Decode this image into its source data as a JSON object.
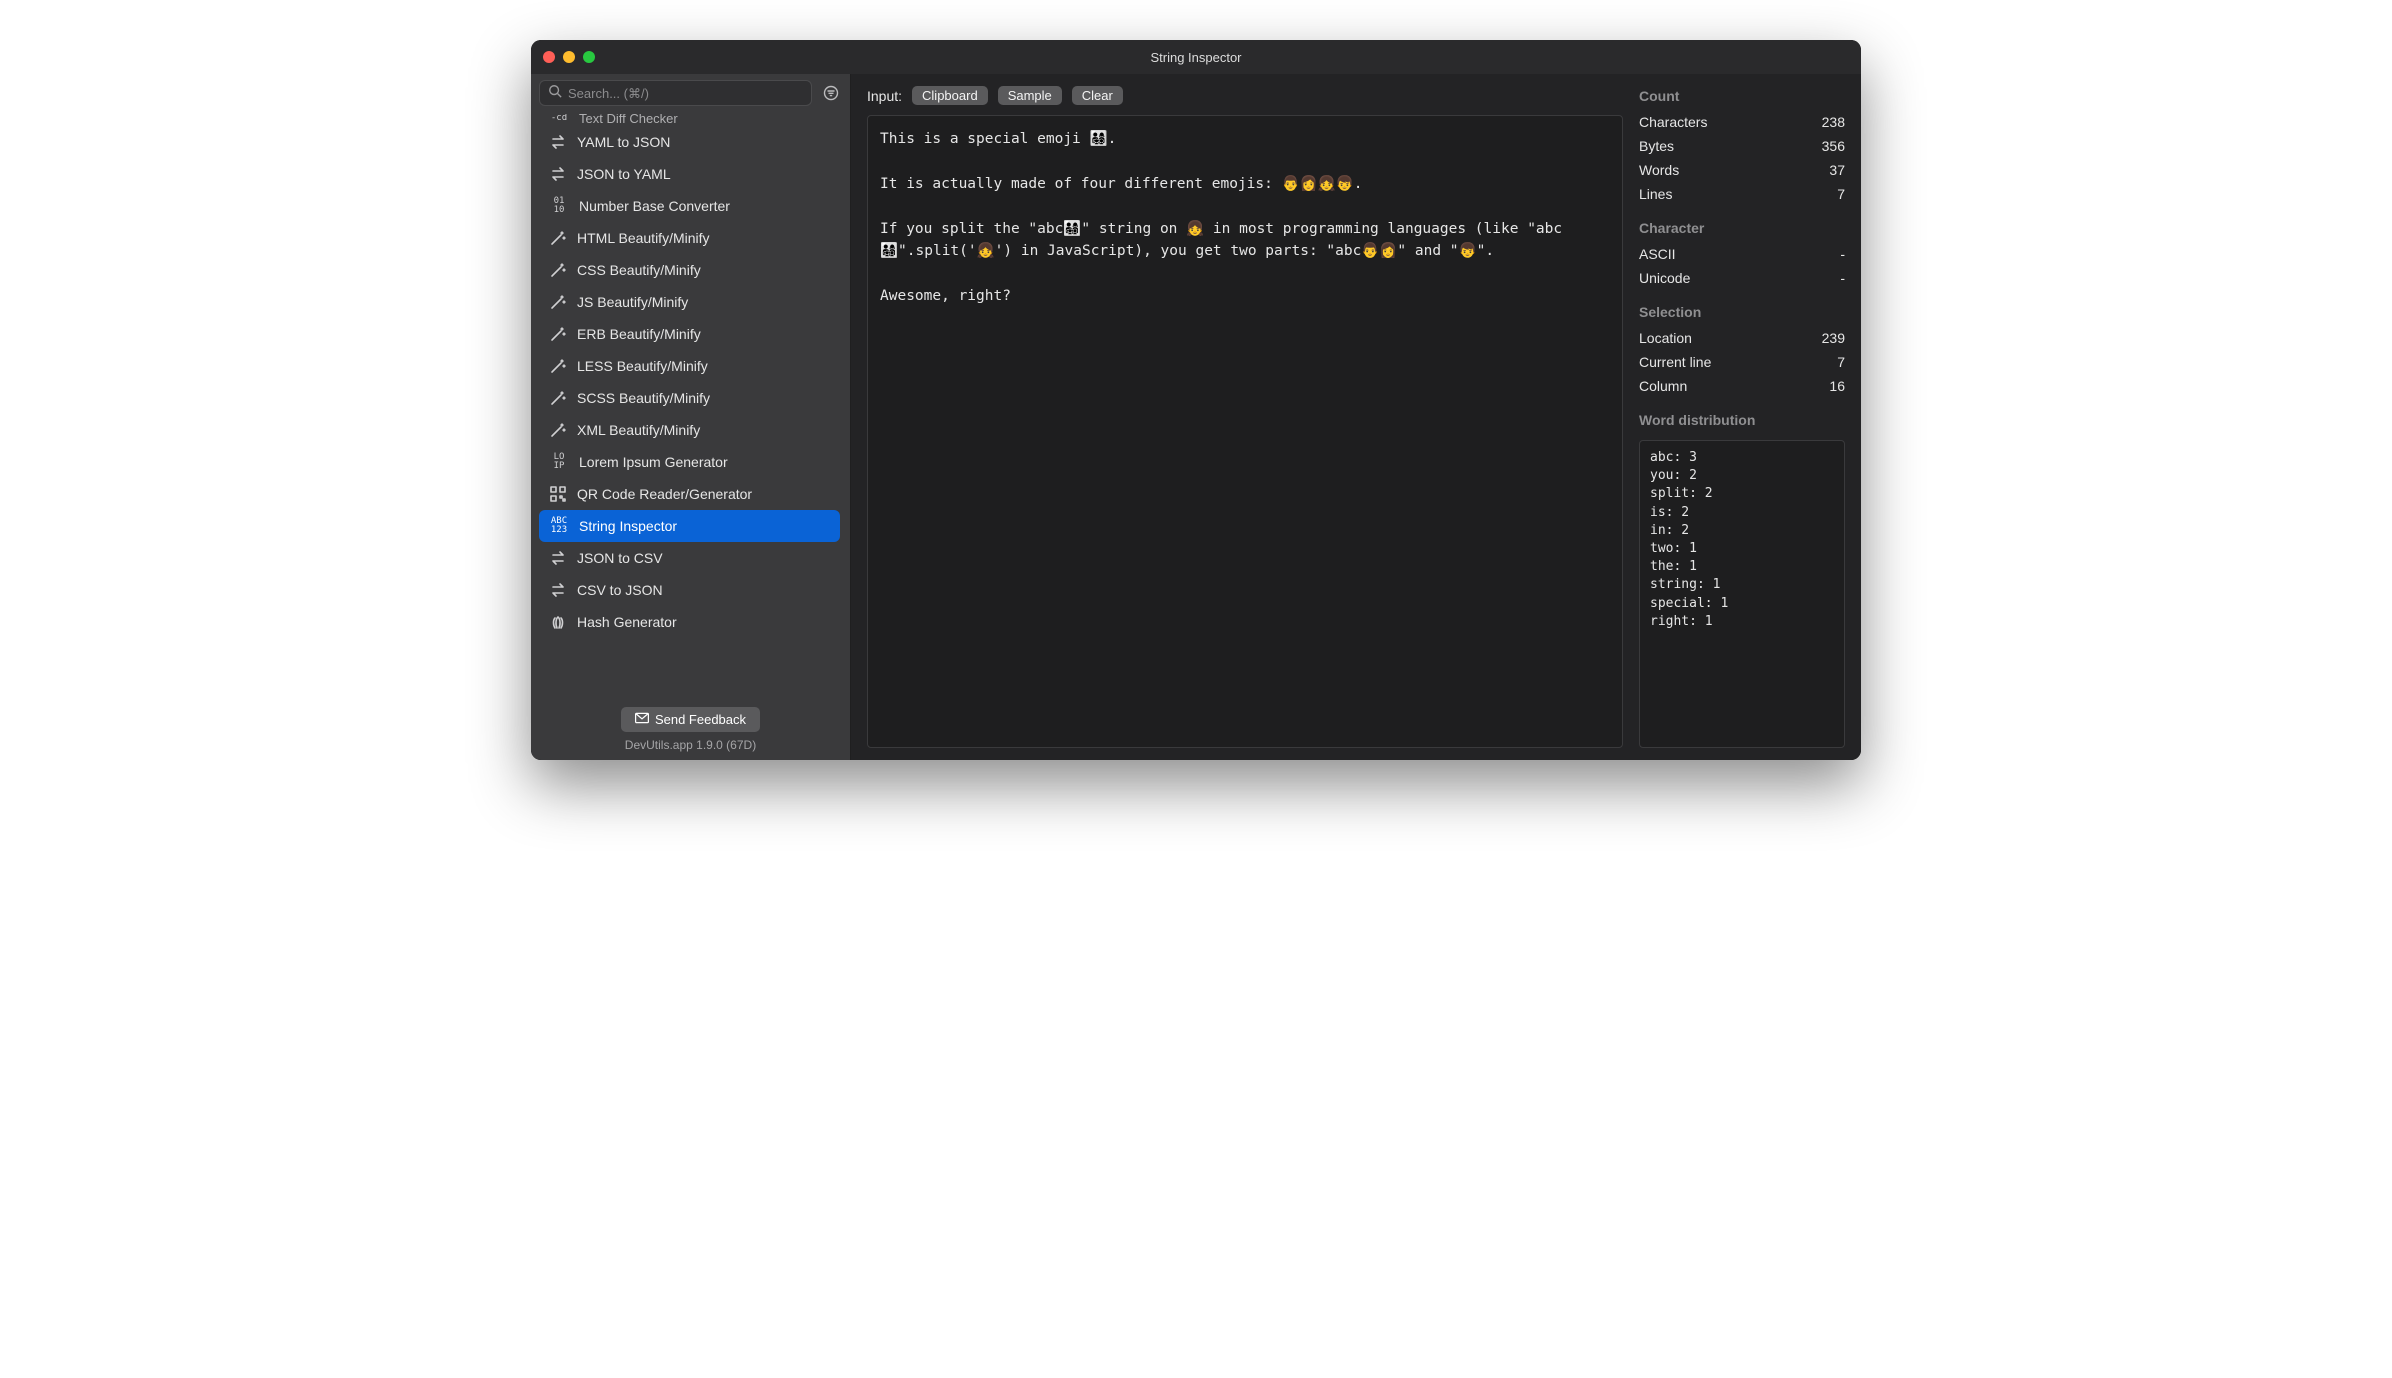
{
  "window": {
    "title": "String Inspector"
  },
  "sidebar": {
    "search_placeholder": "Search... (⌘/)",
    "cutoff_label": "Text Diff Checker",
    "tools": [
      {
        "id": "yaml-to-json",
        "label": "YAML to JSON",
        "icon": "swap"
      },
      {
        "id": "json-to-yaml",
        "label": "JSON to YAML",
        "icon": "swap"
      },
      {
        "id": "number-base",
        "label": "Number Base Converter",
        "icon": "bits"
      },
      {
        "id": "html-beautify",
        "label": "HTML Beautify/Minify",
        "icon": "wand"
      },
      {
        "id": "css-beautify",
        "label": "CSS Beautify/Minify",
        "icon": "wand"
      },
      {
        "id": "js-beautify",
        "label": "JS Beautify/Minify",
        "icon": "wand"
      },
      {
        "id": "erb-beautify",
        "label": "ERB Beautify/Minify",
        "icon": "wand"
      },
      {
        "id": "less-beautify",
        "label": "LESS Beautify/Minify",
        "icon": "wand"
      },
      {
        "id": "scss-beautify",
        "label": "SCSS Beautify/Minify",
        "icon": "wand"
      },
      {
        "id": "xml-beautify",
        "label": "XML Beautify/Minify",
        "icon": "wand"
      },
      {
        "id": "lorem-ipsum",
        "label": "Lorem Ipsum Generator",
        "icon": "lorem"
      },
      {
        "id": "qr",
        "label": "QR Code Reader/Generator",
        "icon": "qr"
      },
      {
        "id": "string-insp",
        "label": "String Inspector",
        "icon": "abc",
        "selected": true
      },
      {
        "id": "json-to-csv",
        "label": "JSON to CSV",
        "icon": "swap"
      },
      {
        "id": "csv-to-json",
        "label": "CSV to JSON",
        "icon": "swap"
      },
      {
        "id": "hash",
        "label": "Hash Generator",
        "icon": "finger"
      }
    ],
    "feedback_label": "Send Feedback",
    "version": "DevUtils.app 1.9.0 (67D)"
  },
  "editor": {
    "input_label": "Input:",
    "buttons": {
      "clipboard": "Clipboard",
      "sample": "Sample",
      "clear": "Clear"
    },
    "text": "This is a special emoji 👨‍👩‍👧‍👦.\n\nIt is actually made of four different emojis: 👨👩👧👦.\n\nIf you split the \"abc👨‍👩‍👧‍👦\" string on 👧 in most programming languages (like \"abc👨‍👩‍👧‍👦\".split('👧') in JavaScript), you get two parts: \"abc👨👩\" and \"👦\".\n\nAwesome, right?"
  },
  "stats": {
    "count_header": "Count",
    "count": {
      "characters": "238",
      "bytes": "356",
      "words": "37",
      "lines": "7"
    },
    "labels": {
      "characters": "Characters",
      "bytes": "Bytes",
      "words": "Words",
      "lines": "Lines"
    },
    "char_header": "Character",
    "char": {
      "ascii": "-",
      "unicode": "-"
    },
    "char_labels": {
      "ascii": "ASCII",
      "unicode": "Unicode"
    },
    "sel_header": "Selection",
    "sel": {
      "location": "239",
      "current_line": "7",
      "column": "16"
    },
    "sel_labels": {
      "location": "Location",
      "current_line": "Current line",
      "column": "Column"
    },
    "dist_header": "Word distribution",
    "dist": [
      "abc: 3",
      "you: 2",
      "split: 2",
      "is: 2",
      "in: 2",
      "two: 1",
      "the: 1",
      "string: 1",
      "special: 1",
      "right: 1"
    ]
  }
}
